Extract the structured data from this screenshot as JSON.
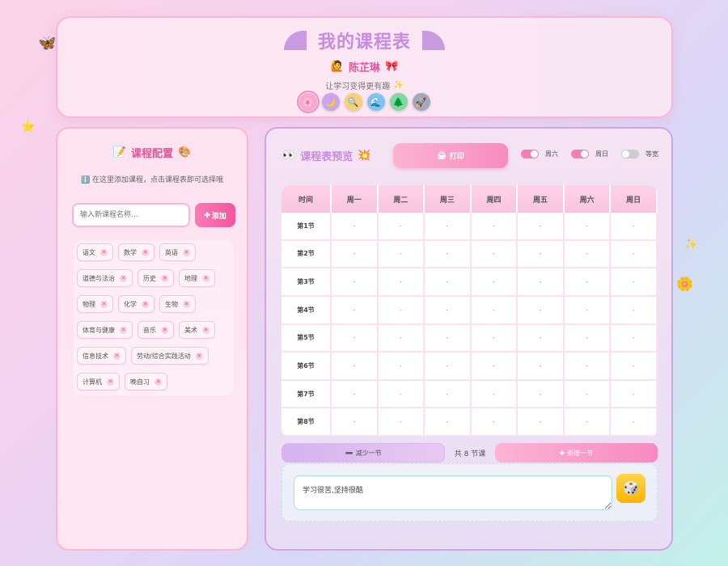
{
  "header": {
    "title": "我的课程表",
    "user_icon": "🙋",
    "user_name": "陈芷琳",
    "bow_icon": "🎀",
    "slogan": "让学习变得更有趣",
    "sparkle_icon": "✨",
    "themes": [
      {
        "name": "flower-theme",
        "icon": "🌸",
        "color": "#f9a8cf"
      },
      {
        "name": "moon-theme",
        "icon": "🌙",
        "color": "#c9a4ef"
      },
      {
        "name": "search-theme",
        "icon": "🔍",
        "color": "#f6d07a"
      },
      {
        "name": "wave-theme",
        "icon": "🌊",
        "color": "#7fc4ef"
      },
      {
        "name": "tree-theme",
        "icon": "🌲",
        "color": "#7fd9a0"
      },
      {
        "name": "rocket-theme",
        "icon": "🚀",
        "color": "#a2a9b8"
      }
    ]
  },
  "left": {
    "title_icon": "📝",
    "title": "课程配置",
    "title_icon2": "🎨",
    "hint_icon": "ℹ️",
    "hint": "在这里添加课程，点击课程表即可选择哦",
    "input_placeholder": "输入新课程名称...",
    "add_label": "添加",
    "courses": [
      "语文",
      "数学",
      "英语",
      "道德与法治",
      "历史",
      "地理",
      "物理",
      "化学",
      "生物",
      "体育与健康",
      "音乐",
      "美术",
      "信息技术",
      "劳动/综合实践活动",
      "计算机",
      "晚自习"
    ]
  },
  "right": {
    "title_icon": "👀",
    "title": "课程表预览",
    "title_icon2": "💥",
    "print_label": "打印",
    "toggles": [
      {
        "label": "周六",
        "on": true
      },
      {
        "label": "周日",
        "on": true
      },
      {
        "label": "等宽",
        "on": false
      }
    ],
    "headers": [
      "时间",
      "周一",
      "周二",
      "周三",
      "周四",
      "周五",
      "周六",
      "周日"
    ],
    "periods": [
      "第1节",
      "第2节",
      "第3节",
      "第4节",
      "第5节",
      "第6节",
      "第7节",
      "第8节"
    ],
    "empty_cell": "-",
    "minus_label": "减少一节",
    "count_label": "共 8 节课",
    "plus_label": "新增一节",
    "note_text": "学习很苦,坚持很酷"
  },
  "colors": {
    "accent_pink": "#f2559e",
    "accent_purple": "#c78be0",
    "dice_yellow": "#ffb300"
  }
}
